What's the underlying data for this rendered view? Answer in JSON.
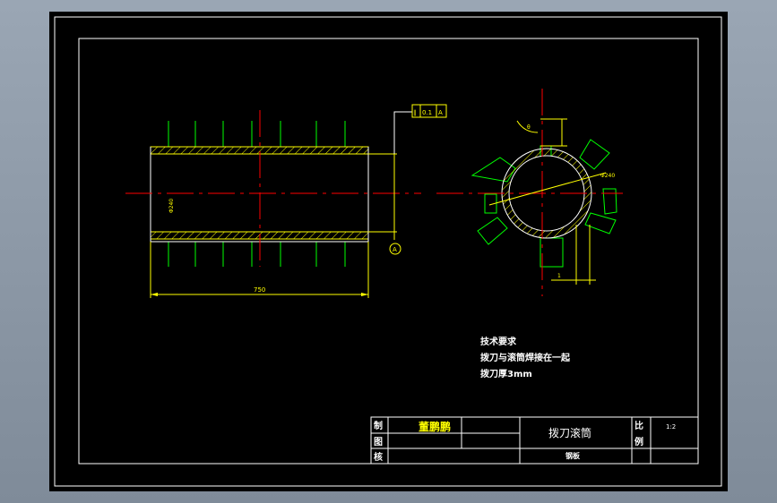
{
  "drawing": {
    "dimensions": {
      "length": "750",
      "diameter_side": "Φ240",
      "diameter_end": "Φ240",
      "blade_width": "1",
      "tolerance_symbol": "∥",
      "tolerance_value": "0.1",
      "datum_ref": "A",
      "datum_marker": "A",
      "angle_label": "θ"
    },
    "tech_requirements": {
      "title": "技术要求",
      "lines": [
        "拨刀与滚筒焊接在一起",
        "拨刀厚3mm"
      ]
    },
    "title_block": {
      "designer_label": "制",
      "drawer_label": "图",
      "checker_label": "核",
      "designer_name": "董鹏鹏",
      "part_name": "拨刀滚筒",
      "material": "钢板",
      "scale_label_1": "比",
      "scale_label_2": "例",
      "scale_value": "1:2"
    }
  },
  "colors": {
    "background": "#000000",
    "border": "#ffffff",
    "part_outline": "#ffff00",
    "center_line": "#ff0000",
    "hatching": "#00ff00",
    "title_name": "#ffff00"
  }
}
